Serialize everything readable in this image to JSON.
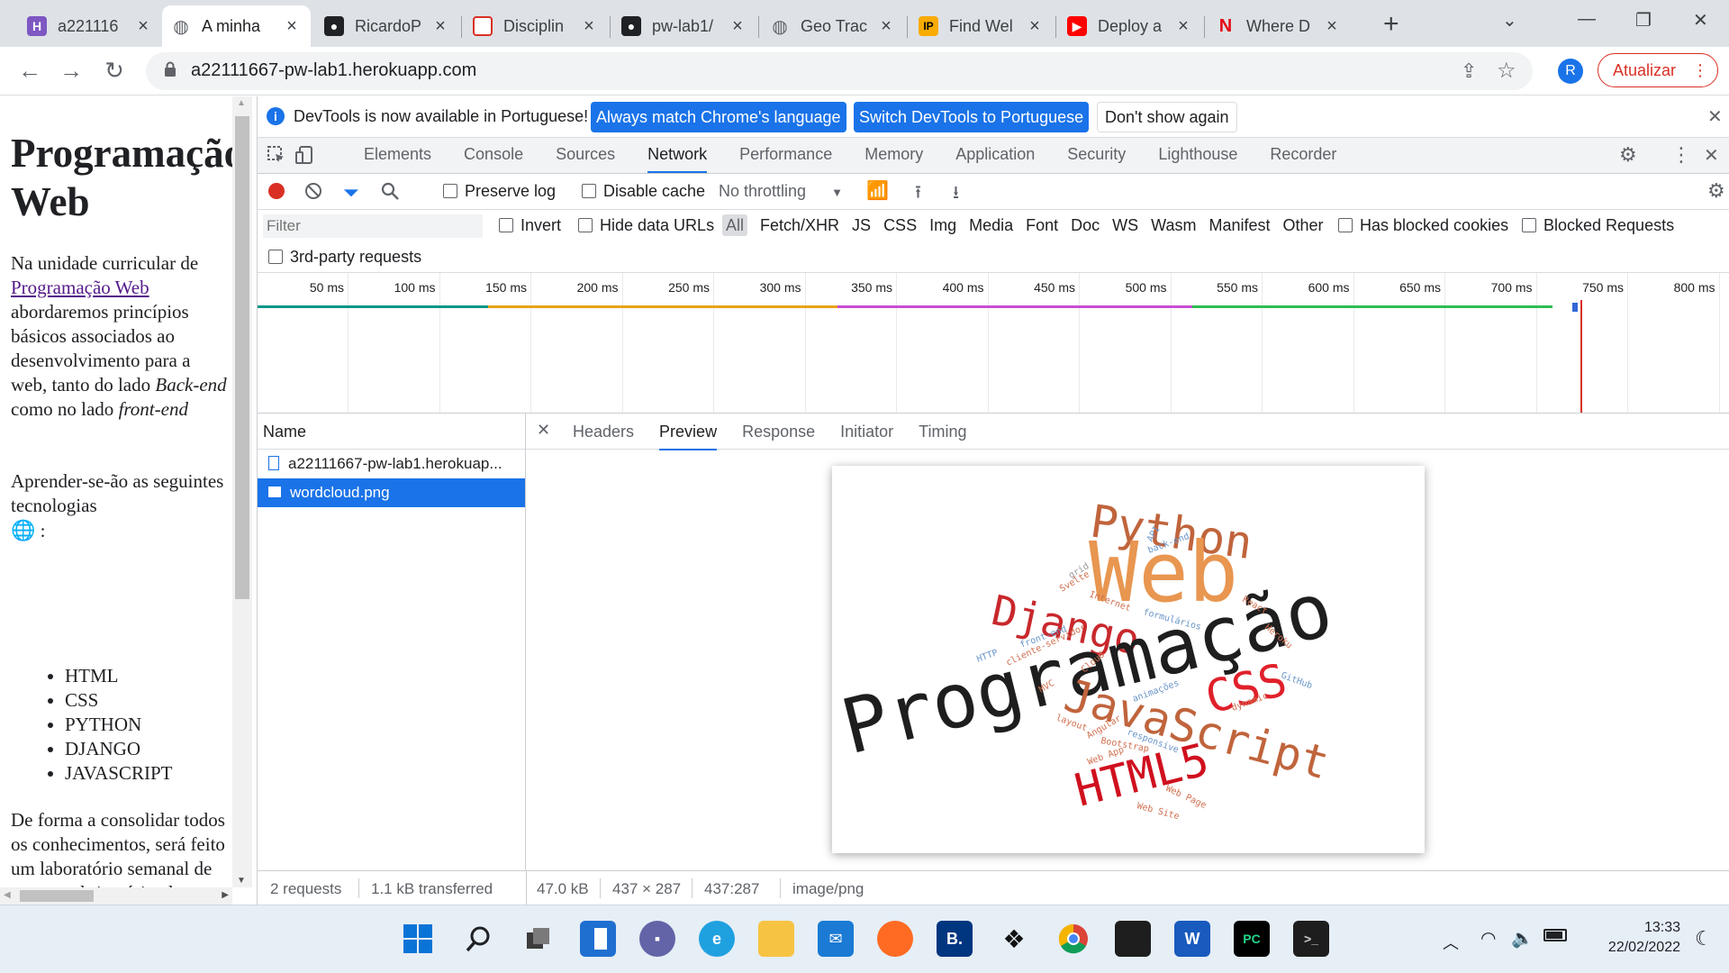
{
  "tabs": [
    {
      "title": "a221116",
      "favicon": "H",
      "color": "#7e57c2"
    },
    {
      "title": "A minha",
      "favicon": "globe",
      "color": "#5f6368",
      "active": true
    },
    {
      "title": "RicardoP",
      "favicon": "github",
      "color": "#202124"
    },
    {
      "title": "Disciplin",
      "favicon": "box",
      "color": "#d93025"
    },
    {
      "title": "pw-lab1/",
      "favicon": "github",
      "color": "#202124"
    },
    {
      "title": "Geo Trac",
      "favicon": "globe",
      "color": "#5f6368"
    },
    {
      "title": "Find Wel",
      "favicon": "IP",
      "color": "#f9ab00"
    },
    {
      "title": "Deploy a",
      "favicon": "youtube",
      "color": "#ff0000"
    },
    {
      "title": "Where D",
      "favicon": "N",
      "color": "#e50914"
    }
  ],
  "new_tab": "+",
  "address": "a22111667-pw-lab1.herokuapp.com",
  "profile_initial": "R",
  "update_label": "Atualizar",
  "page": {
    "title": "Programação Web",
    "para1_a": "Na unidade curricular de ",
    "para1_link": "Programação Web",
    "para1_b": " abordaremos princípios básicos associados ao desenvolvimento para a web, tanto do lado ",
    "para1_em1": "Back-end",
    "para1_c": " como no lado ",
    "para1_em2": "front-end",
    "para2": "Aprender-se-ão as seguintes tecnologias",
    "list": [
      "HTML",
      "CSS",
      "PYTHON",
      "DJANGO",
      "JAVASCRIPT"
    ],
    "para3": "De forma a consolidar todos os conhecimentos, será feito um laboratório semanal de entrega obrigatória, de aplicação da matéria lecionada"
  },
  "devtools": {
    "infobar_text": "DevTools is now available in Portuguese!",
    "btn_match": "Always match Chrome's language",
    "btn_switch": "Switch DevTools to Portuguese",
    "btn_dont_show": "Don't show again",
    "tabs": [
      "Elements",
      "Console",
      "Sources",
      "Network",
      "Performance",
      "Memory",
      "Application",
      "Security",
      "Lighthouse",
      "Recorder"
    ],
    "active_tab": "Network",
    "preserve_log": "Preserve log",
    "disable_cache": "Disable cache",
    "throttling": "No throttling",
    "filter_placeholder": "Filter",
    "invert": "Invert",
    "hide_data_urls": "Hide data URLs",
    "filter_types": [
      "All",
      "Fetch/XHR",
      "JS",
      "CSS",
      "Img",
      "Media",
      "Font",
      "Doc",
      "WS",
      "Wasm",
      "Manifest",
      "Other"
    ],
    "has_blocked_cookies": "Has blocked cookies",
    "blocked_requests": "Blocked Requests",
    "third_party": "3rd-party requests",
    "timeline_ticks": [
      "50 ms",
      "100 ms",
      "150 ms",
      "200 ms",
      "250 ms",
      "300 ms",
      "350 ms",
      "400 ms",
      "450 ms",
      "500 ms",
      "550 ms",
      "600 ms",
      "650 ms",
      "700 ms",
      "750 ms",
      "800 ms"
    ],
    "name_header": "Name",
    "requests": [
      {
        "name": "a22111667-pw-lab1.herokuap...",
        "type": "doc"
      },
      {
        "name": "wordcloud.png",
        "type": "img",
        "selected": true
      }
    ],
    "detail_tabs": [
      "Headers",
      "Preview",
      "Response",
      "Initiator",
      "Timing"
    ],
    "detail_active": "Preview",
    "status_requests": "2 requests",
    "status_transferred": "1.1 kB transferred",
    "preview_size": "47.0 kB",
    "preview_dims": "437 × 287",
    "preview_ratio": "437:287",
    "preview_mime": "image/png"
  },
  "wordcloud": {
    "big": [
      "Programação",
      "Web",
      "Python",
      "Django",
      "CSS",
      "JavaScript",
      "HTML5"
    ],
    "small": [
      "API",
      "back-end",
      "grid",
      "Svelte",
      "Internet",
      "formulários",
      "React",
      "front-end",
      "cliente-servidor",
      "HTTP",
      "Heroku",
      "Cloud",
      "GitHub",
      "MVC",
      "animações",
      "dynamic",
      "layout",
      "Angular",
      "responsive",
      "Bootstrap",
      "Web App",
      "Web Page",
      "Web Site"
    ]
  },
  "clock": {
    "time": "13:33",
    "date": "22/02/2022"
  }
}
